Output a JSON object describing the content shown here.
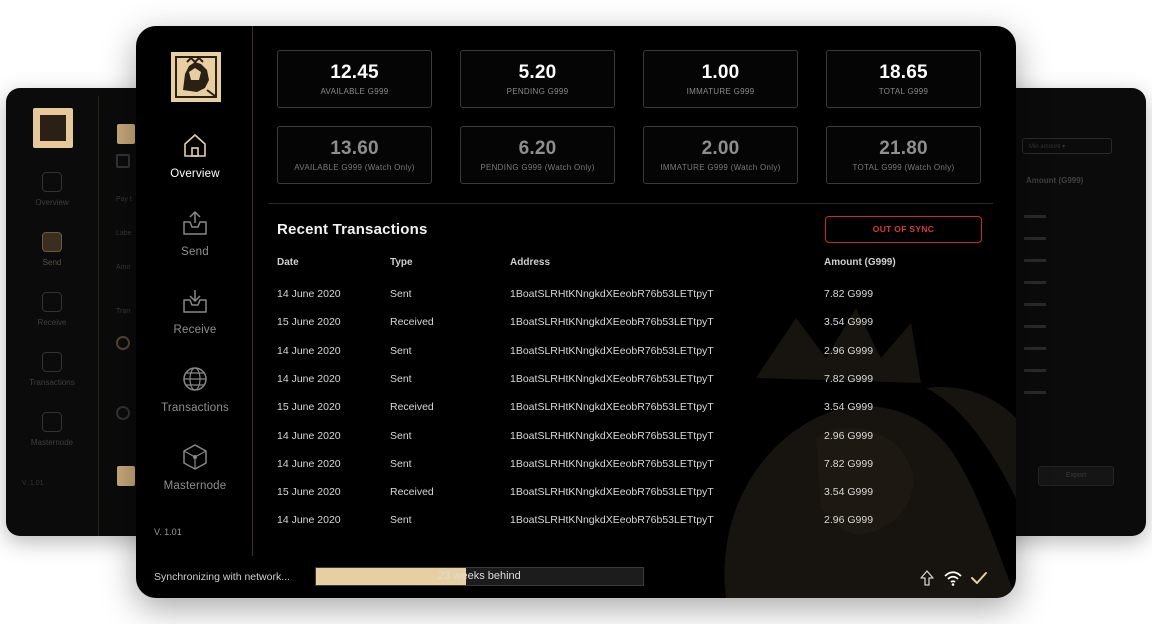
{
  "app": {
    "version": "V. 1.01"
  },
  "colors": {
    "accent": "#e8cfa2",
    "gold": "#c8a878",
    "out_of_sync": "#d8393a",
    "bg": "#000000"
  },
  "sidebar": {
    "items": [
      {
        "label": "Overview",
        "icon": "home-icon",
        "active": true
      },
      {
        "label": "Send",
        "icon": "send-tray-icon",
        "active": false
      },
      {
        "label": "Receive",
        "icon": "receive-tray-icon",
        "active": false
      },
      {
        "label": "Transactions",
        "icon": "globe-icon",
        "active": false
      },
      {
        "label": "Masternode",
        "icon": "cube-network-icon",
        "active": false
      }
    ]
  },
  "balances": [
    {
      "value": "12.45",
      "label": "AVAILABLE G999"
    },
    {
      "value": "5.20",
      "label": "PENDING G999"
    },
    {
      "value": "1.00",
      "label": "IMMATURE G999"
    },
    {
      "value": "18.65",
      "label": "TOTAL G999"
    }
  ],
  "watch_balances": [
    {
      "value": "13.60",
      "label": "AVAILABLE G999 (Watch Only)"
    },
    {
      "value": "6.20",
      "label": "PENDING G999 (Watch Only)"
    },
    {
      "value": "2.00",
      "label": "IMMATURE G999 (Watch Only)"
    },
    {
      "value": "21.80",
      "label": "TOTAL G999 (Watch Only)"
    }
  ],
  "transactions": {
    "title": "Recent Transactions",
    "sync_button": "OUT OF SYNC",
    "columns": {
      "date": "Date",
      "type": "Type",
      "address": "Address",
      "amount": "Amount (G999)"
    },
    "rows": [
      {
        "date": "14 June 2020",
        "type": "Sent",
        "address": "1BoatSLRHtKNngkdXEeobR76b53LETtpyT",
        "amount": "7.82 G999"
      },
      {
        "date": "15 June 2020",
        "type": "Received",
        "address": "1BoatSLRHtKNngkdXEeobR76b53LETtpyT",
        "amount": "3.54 G999"
      },
      {
        "date": "14 June 2020",
        "type": "Sent",
        "address": "1BoatSLRHtKNngkdXEeobR76b53LETtpyT",
        "amount": "2.96 G999"
      },
      {
        "date": "14 June 2020",
        "type": "Sent",
        "address": "1BoatSLRHtKNngkdXEeobR76b53LETtpyT",
        "amount": "7.82 G999"
      },
      {
        "date": "15 June 2020",
        "type": "Received",
        "address": "1BoatSLRHtKNngkdXEeobR76b53LETtpyT",
        "amount": "3.54 G999"
      },
      {
        "date": "14 June 2020",
        "type": "Sent",
        "address": "1BoatSLRHtKNngkdXEeobR76b53LETtpyT",
        "amount": "2.96 G999"
      },
      {
        "date": "14 June 2020",
        "type": "Sent",
        "address": "1BoatSLRHtKNngkdXEeobR76b53LETtpyT",
        "amount": "7.82 G999"
      },
      {
        "date": "15 June 2020",
        "type": "Received",
        "address": "1BoatSLRHtKNngkdXEeobR76b53LETtpyT",
        "amount": "3.54 G999"
      },
      {
        "date": "14 June 2020",
        "type": "Sent",
        "address": "1BoatSLRHtKNngkdXEeobR76b53LETtpyT",
        "amount": "2.96 G999"
      }
    ]
  },
  "status_bar": {
    "text": "Synchronizing with network...",
    "progress_label": "23 weeks behind",
    "progress_fraction": 0.46,
    "icons": [
      "upload-arrow-icon",
      "wifi-icon",
      "checkmark-icon"
    ]
  }
}
